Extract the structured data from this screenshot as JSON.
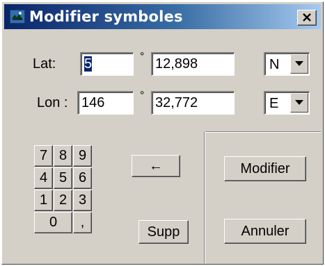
{
  "window": {
    "title": "Modifier symboles",
    "close_glyph": "✕"
  },
  "lat": {
    "label": "Lat:",
    "degrees": "5",
    "degree_symbol": "°",
    "minutes": "12,898",
    "hemisphere": "N"
  },
  "lon": {
    "label": "Lon :",
    "degrees": "146",
    "degree_symbol": "°",
    "minutes": "32,772",
    "hemisphere": "E"
  },
  "keypad": {
    "keys": [
      "7",
      "8",
      "9",
      "4",
      "5",
      "6",
      "1",
      "2",
      "3"
    ],
    "zero": "0",
    "decimal": ","
  },
  "buttons": {
    "backspace": "←",
    "supp": "Supp",
    "modifier": "Modifier",
    "annuler": "Annuler"
  },
  "icons": {
    "app": "map-app-icon",
    "close": "close-icon",
    "dropdown": "chevron-down-icon"
  },
  "colors": {
    "title_gradient_start": "#0a246a",
    "title_gradient_end": "#a6caf0",
    "face": "#d4d0c8",
    "selection": "#0a246a"
  }
}
